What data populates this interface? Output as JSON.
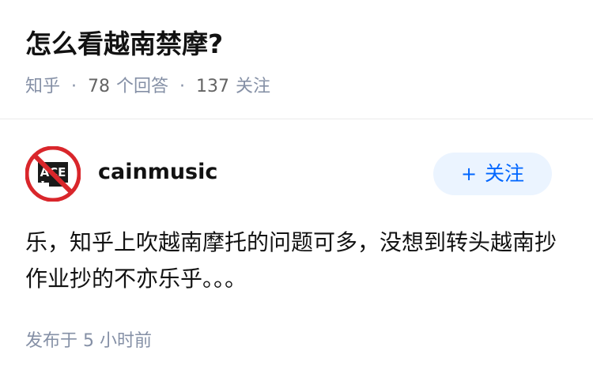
{
  "question": {
    "title": "怎么看越南禁摩?",
    "source": "知乎",
    "answer_count": "78",
    "answer_label": "个回答",
    "follow_count": "137",
    "follow_label": "关注",
    "separator": "·"
  },
  "answer": {
    "author": {
      "name": "cainmusic",
      "avatar_icon": "no-ace-logo-icon",
      "follow_button_label": "关注",
      "follow_button_icon": "+"
    },
    "content": "乐，知乎上吹越南摩托的问题可多，没想到转头越南抄作业抄的不亦乐乎。。。",
    "published": "发布于  5 小时前"
  },
  "colors": {
    "accent": "#0066ff",
    "follow_bg": "#ebf4ff",
    "meta_text": "#8590a6",
    "avatar_red": "#d9262b"
  }
}
